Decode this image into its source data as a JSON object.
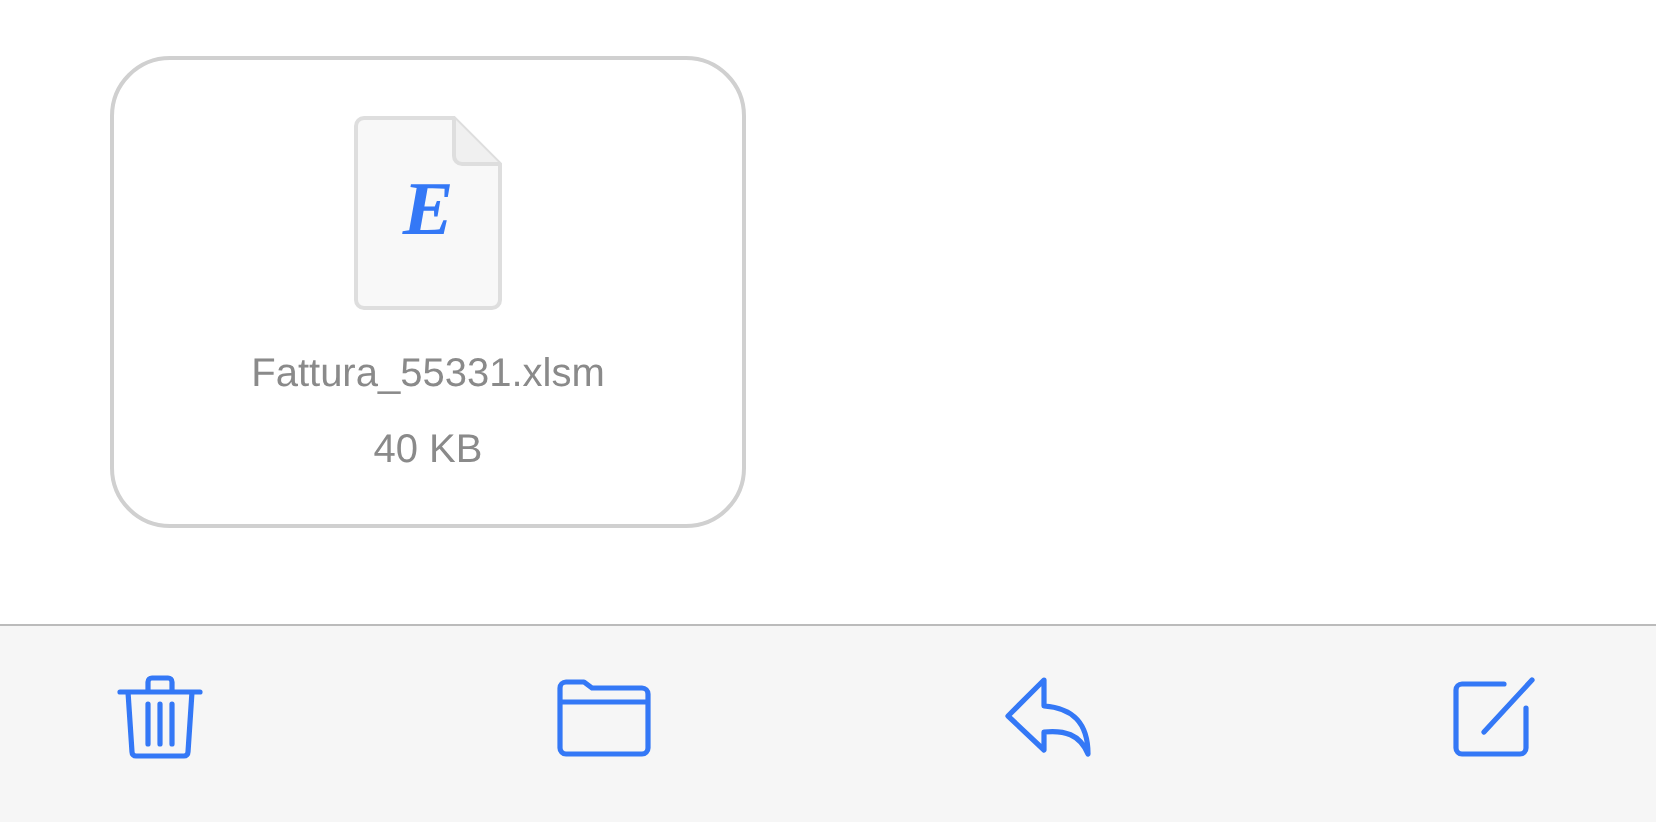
{
  "attachment": {
    "icon_letter": "E",
    "file_name": "Fattura_55331.xlsm",
    "file_size": "40 KB"
  },
  "toolbar": {
    "buttons": [
      {
        "kind": "trash"
      },
      {
        "kind": "folder"
      },
      {
        "kind": "reply"
      },
      {
        "kind": "compose"
      }
    ]
  }
}
